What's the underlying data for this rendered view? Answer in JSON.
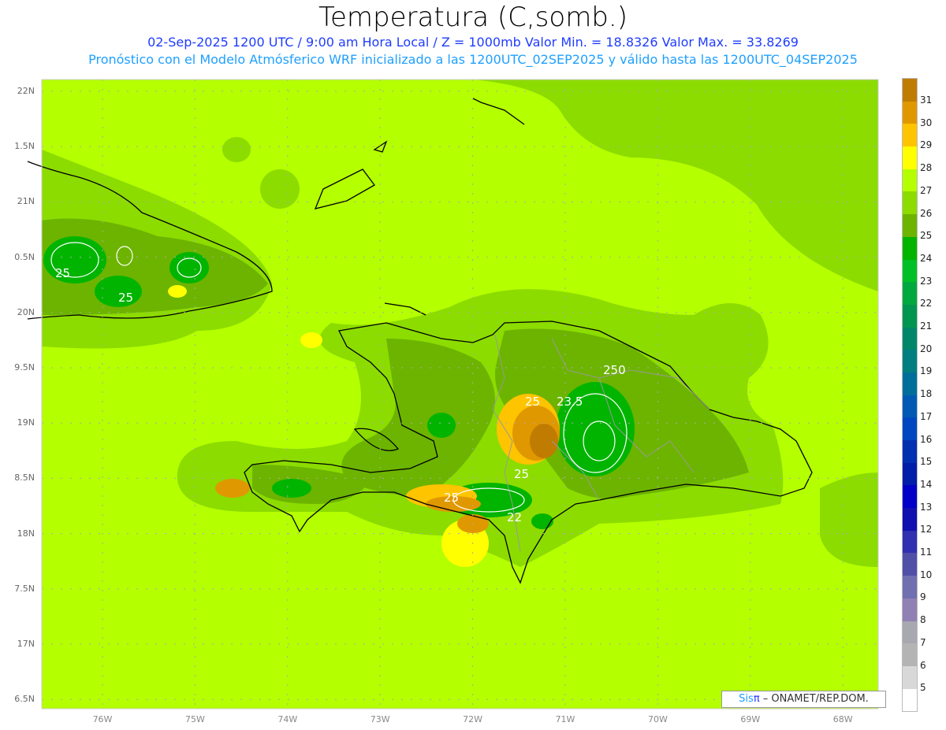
{
  "title": "Temperatura (C,somb.)",
  "subtitle1": "02-Sep-2025  1200 UTC / 9:00 am Hora Local / Z = 1000mb   Valor Min. = 18.8326  Valor Max. = 33.8269",
  "subtitle2": "Pronóstico con el Modelo Atmósferico WRF inicializado a las 1200UTC_02SEP2025 y válido hasta las  1200UTC_04SEP2025",
  "lat_labels": [
    "22N",
    "1.5N",
    "21N",
    "0.5N",
    "20N",
    "9.5N",
    "19N",
    "8.5N",
    "18N",
    "7.5N",
    "17N",
    "6.5N"
  ],
  "lon_labels": [
    "76W",
    "75W",
    "74W",
    "73W",
    "72W",
    "71W",
    "70W",
    "69W",
    "68W"
  ],
  "contour_labels": [
    "25",
    "25",
    "25",
    "25",
    "23.5",
    "25",
    "25",
    "22",
    "250"
  ],
  "colorbar": {
    "labels": [
      "31",
      "30",
      "29",
      "28",
      "27",
      "26",
      "25",
      "24",
      "23",
      "22",
      "21",
      "20",
      "19",
      "18",
      "17",
      "16",
      "15",
      "14",
      "13",
      "12",
      "11",
      "10",
      "9",
      "8",
      "7",
      "6",
      "5"
    ],
    "colors": [
      "#c07c00",
      "#e09800",
      "#ffc400",
      "#ffff00",
      "#b4ff00",
      "#8cdc00",
      "#6cb400",
      "#00b400",
      "#00c028",
      "#00a840",
      "#009650",
      "#00876a",
      "#007e80",
      "#006e9a",
      "#005ab4",
      "#0046c0",
      "#0030b0",
      "#001ea8",
      "#0000c8",
      "#1010b0",
      "#3030b0",
      "#5050a8",
      "#7070b0",
      "#9080b4",
      "#a8a8b0",
      "#b4b4b4",
      "#d8d8d8",
      "#ffffff"
    ]
  },
  "credit": {
    "brand": "Sis",
    "pi": "π",
    "text": "– ONAMET/REP.DOM."
  }
}
